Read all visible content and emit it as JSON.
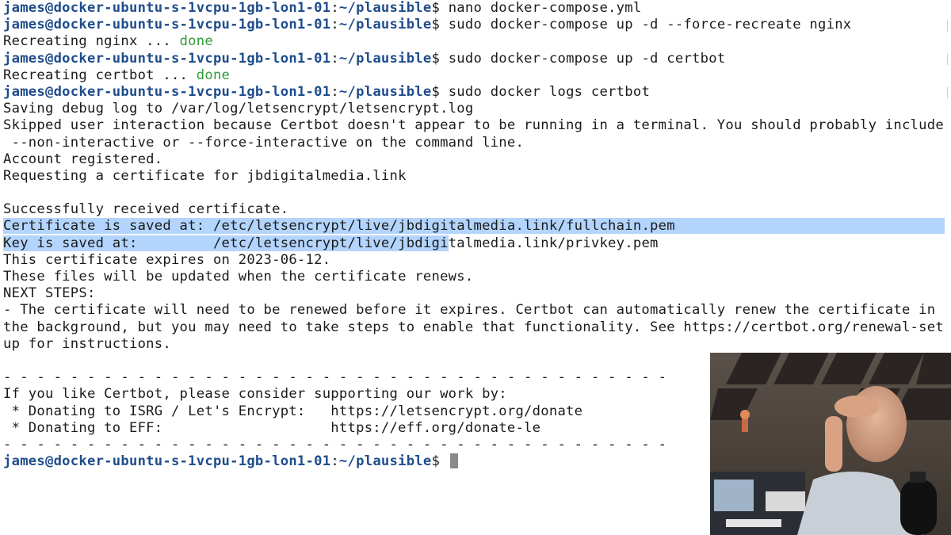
{
  "prompt": {
    "user_host": "james@docker-ubuntu-s-1vcpu-1gb-lon1-01",
    "separator": ":",
    "path": "~/plausible",
    "symbol": "$ "
  },
  "commands": [
    "nano docker-compose.yml",
    "sudo docker-compose up -d --force-recreate nginx",
    "sudo docker-compose up -d certbot",
    "sudo docker logs certbot"
  ],
  "recreate_nginx": {
    "text": "Recreating nginx ... ",
    "status": "done"
  },
  "recreate_certbot": {
    "text": "Recreating certbot ... ",
    "status": "done"
  },
  "log_lines": {
    "saving": "Saving debug log to /var/log/letsencrypt/letsencrypt.log",
    "skipped_1": "Skipped user interaction because Certbot doesn't appear to be running in a terminal. You should probably include",
    "skipped_2": " --non-interactive or --force-interactive on the command line.",
    "account": "Account registered.",
    "requesting": "Requesting a certificate for jbdigitalmedia.link",
    "success": "Successfully received certificate.",
    "cert_label": "Certificate is saved at: ",
    "cert_path": "/etc/letsencrypt/live/jbdigitalmedia.link/fullchain.pem",
    "key_label": "Key is saved at:         ",
    "key_path_selected": "/etc/letsencrypt/live/jbdigi",
    "key_path_rest": "talmedia.link/privkey.pem",
    "expires": "This certificate expires on 2023-06-12.",
    "updated": "These files will be updated when the certificate renews.",
    "next_steps": "NEXT STEPS:",
    "renew_1": "- The certificate will need to be renewed before it expires. Certbot can automatically renew the certificate in",
    "renew_2": "the background, but you may need to take steps to enable that functionality. See https://certbot.org/renewal-set",
    "renew_3": "up for instructions.",
    "divider": "- - - - - - - - - - - - - - - - - - - - - - - - - - - - - - - - - - - - - - - -",
    "support": "If you like Certbot, please consider supporting our work by:",
    "donate_isrg": " * Donating to ISRG / Let's Encrypt:   https://letsencrypt.org/donate",
    "donate_eff": " * Donating to EFF:                    https://eff.org/donate-le"
  },
  "colors": {
    "prompt": "#1f4d8c",
    "done": "#2f9a3a",
    "selection": "#b3d4fc",
    "text": "#1b1b1b"
  },
  "webcam": {
    "description": "presenter-webcam-overlay"
  }
}
